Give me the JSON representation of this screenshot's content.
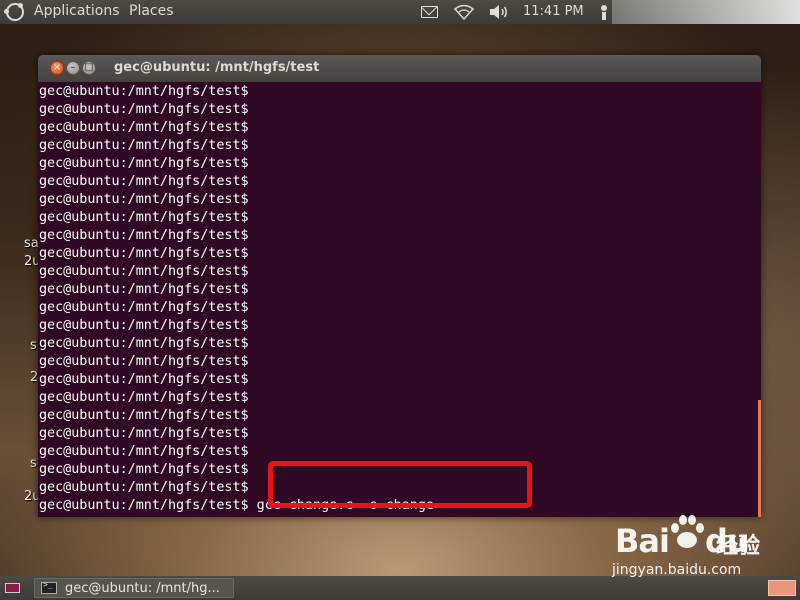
{
  "top_panel": {
    "applications": "Applications",
    "places": "Places",
    "clock": "11:41 PM",
    "icons": [
      "ubuntu-logo-icon",
      "mail-icon",
      "wifi-icon",
      "volume-icon",
      "user-icon"
    ]
  },
  "desktop_labels": [
    "sa",
    "2u",
    "s",
    "2",
    "s",
    "2u"
  ],
  "window": {
    "title": "gec@ubuntu: /mnt/hgfs/test",
    "terminal": {
      "prompt": "gec@ubuntu:/mnt/hgfs/test$",
      "lines": [
        "gec@ubuntu:/mnt/hgfs/test$",
        "gec@ubuntu:/mnt/hgfs/test$",
        "gec@ubuntu:/mnt/hgfs/test$",
        "gec@ubuntu:/mnt/hgfs/test$",
        "gec@ubuntu:/mnt/hgfs/test$",
        "gec@ubuntu:/mnt/hgfs/test$",
        "gec@ubuntu:/mnt/hgfs/test$",
        "gec@ubuntu:/mnt/hgfs/test$",
        "gec@ubuntu:/mnt/hgfs/test$",
        "gec@ubuntu:/mnt/hgfs/test$",
        "gec@ubuntu:/mnt/hgfs/test$",
        "gec@ubuntu:/mnt/hgfs/test$",
        "gec@ubuntu:/mnt/hgfs/test$",
        "gec@ubuntu:/mnt/hgfs/test$",
        "gec@ubuntu:/mnt/hgfs/test$",
        "gec@ubuntu:/mnt/hgfs/test$",
        "gec@ubuntu:/mnt/hgfs/test$",
        "gec@ubuntu:/mnt/hgfs/test$",
        "gec@ubuntu:/mnt/hgfs/test$",
        "gec@ubuntu:/mnt/hgfs/test$",
        "gec@ubuntu:/mnt/hgfs/test$",
        "gec@ubuntu:/mnt/hgfs/test$",
        "gec@ubuntu:/mnt/hgfs/test$",
        "gec@ubuntu:/mnt/hgfs/test$",
        "gec@ubuntu:/mnt/hgfs/test$"
      ],
      "command": "gcc change.c -o change",
      "command_line_index": 23
    }
  },
  "bottom_panel": {
    "task_label": "gec@ubuntu: /mnt/hg..."
  },
  "watermark": {
    "logo": "Bai",
    "logo_suffix": "du",
    "text": "经验",
    "url": "jingyan.baidu.com"
  },
  "colors": {
    "terminal_bg": "#300a24",
    "highlight": "#e8131a",
    "panel": "#3c3b37"
  }
}
